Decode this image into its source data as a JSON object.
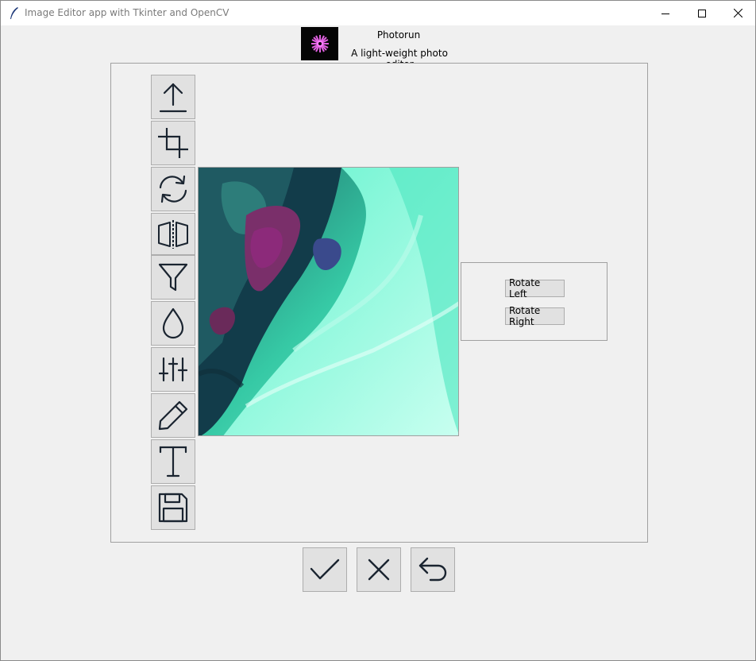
{
  "window": {
    "title": "Image Editor app with Tkinter and OpenCV",
    "controls": [
      "minimize-icon",
      "maximize-icon",
      "close-icon"
    ]
  },
  "header": {
    "title": "Photorun",
    "subtitle": "A light-weight photo editor",
    "logo_icon": "flower-logo-icon",
    "logo_color": "#e060e0"
  },
  "toolbar": {
    "tools": [
      {
        "name": "upload",
        "icon": "upload-icon"
      },
      {
        "name": "crop",
        "icon": "crop-icon"
      },
      {
        "name": "rotate",
        "icon": "rotate-icon"
      },
      {
        "name": "flip",
        "icon": "flip-icon"
      },
      {
        "name": "filter",
        "icon": "filter-icon"
      },
      {
        "name": "blur",
        "icon": "drop-icon"
      },
      {
        "name": "adjust",
        "icon": "sliders-icon"
      },
      {
        "name": "draw",
        "icon": "pencil-icon"
      },
      {
        "name": "text",
        "icon": "text-icon"
      },
      {
        "name": "save",
        "icon": "save-icon"
      }
    ]
  },
  "options_panel": {
    "rotate_left_label": "Rotate Left",
    "rotate_right_label": "Rotate Right"
  },
  "actions": {
    "apply_icon": "checkmark-icon",
    "cancel_icon": "close-x-icon",
    "undo_icon": "undo-icon"
  },
  "colors": {
    "icon_stroke": "#1a2430",
    "button_bg": "#e1e1e1",
    "window_bg": "#f0f0f0"
  }
}
